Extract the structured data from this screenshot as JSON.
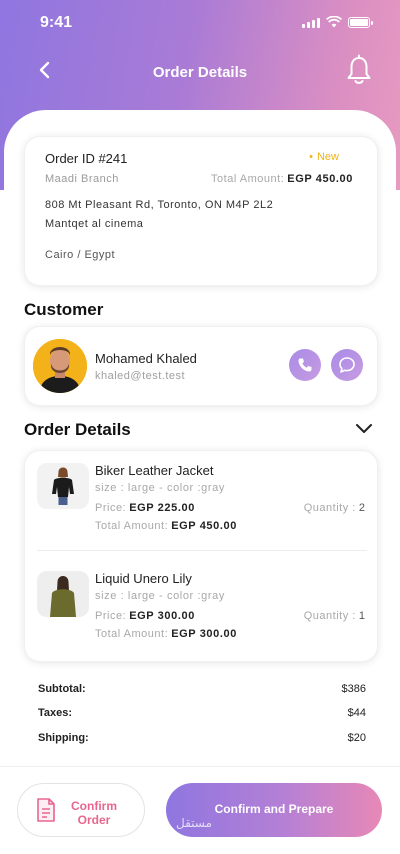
{
  "status_bar": {
    "time": "9:41"
  },
  "header": {
    "title": "Order Details"
  },
  "order": {
    "id": "Order ID #241",
    "status": "New",
    "branch": "Maadi Branch",
    "total_label": "Total Amount:",
    "total_value": "EGP 450.00",
    "address_line1": "808 Mt Pleasant Rd, Toronto, ON M4P 2L2",
    "address_line2": "Mantqet al cinema",
    "city": "Cairo / Egypt"
  },
  "customer": {
    "section_title": "Customer",
    "name": "Mohamed Khaled",
    "email": "khaled@test.test"
  },
  "order_details": {
    "section_title": "Order Details",
    "items": [
      {
        "name": "Biker Leather Jacket",
        "size": "size : large - color :gray",
        "price_label": "Price:",
        "price": "EGP 225.00",
        "total_label": "Total Amount:",
        "total": "EGP 450.00",
        "qty_label": "Quantity :",
        "qty": "2"
      },
      {
        "name": "Liquid Unero Lily",
        "size": "size : large - color :gray",
        "price_label": "Price:",
        "price": "EGP 300.00",
        "total_label": "Total Amount:",
        "total": "EGP 300.00",
        "qty_label": "Quantity :",
        "qty": "1"
      }
    ]
  },
  "summary": {
    "subtotal_label": "Subtotal:",
    "subtotal": "$386",
    "taxes_label": "Taxes:",
    "taxes": "$44",
    "shipping_label": "Shipping:",
    "shipping": "$20"
  },
  "actions": {
    "confirm_order": "Confirm Order",
    "confirm_prepare": "Confirm and Prepare"
  },
  "watermark": "مستقل",
  "colors": {
    "gradient_start": "#8f76e0",
    "gradient_end": "#e79ac0",
    "new_badge": "#f2b417",
    "confirm_text": "#e7668f"
  },
  "icons": [
    "back-arrow-icon",
    "bell-icon",
    "phone-icon",
    "chat-icon",
    "chevron-down-icon",
    "document-icon"
  ]
}
